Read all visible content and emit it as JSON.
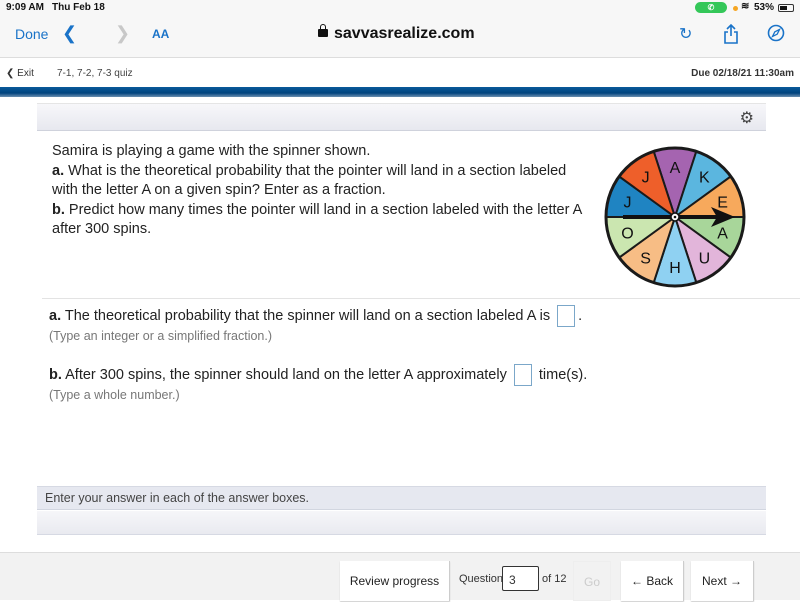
{
  "status_bar": {
    "time": "9:09 AM",
    "date": "Thu Feb 18",
    "call_icon": "phone-icon",
    "wifi_icon": "wifi-icon",
    "battery_percent": "53%"
  },
  "browser": {
    "done_label": "Done",
    "back_icon": "chevron-left-icon",
    "forward_icon": "chevron-right-icon",
    "text_size_label": "AA",
    "url": "savvasrealize.com",
    "reload_icon": "reload-icon",
    "share_icon": "share-icon",
    "compass_icon": "compass-icon"
  },
  "subheader": {
    "exit_label": "Exit",
    "quiz_title": "7-1, 7-2, 7-3 quiz",
    "due": "Due 02/18/21 11:30am"
  },
  "question": {
    "settings_icon": "gear-icon",
    "intro": "Samira is playing a game with the spinner shown.",
    "part_a_label": "a.",
    "part_a_text": " What is the theoretical probability that the pointer will land in a section labeled with the letter A on a given spin? Enter as a fraction.",
    "part_b_label": "b.",
    "part_b_text": " Predict how many times the pointer will land in a section labeled with the letter A after 300 spins.",
    "spinner": {
      "sections": [
        {
          "letter": "A",
          "color": "#a564b0"
        },
        {
          "letter": "K",
          "color": "#5bb6df"
        },
        {
          "letter": "E",
          "color": "#f7a95c"
        },
        {
          "letter": "A",
          "color": "#a8d69a"
        },
        {
          "letter": "U",
          "color": "#e2b5da"
        },
        {
          "letter": "H",
          "color": "#8fd1f2"
        },
        {
          "letter": "S",
          "color": "#f7bd85"
        },
        {
          "letter": "O",
          "color": "#cbe6b0"
        },
        {
          "letter": "J",
          "color": "#1f84c2"
        },
        {
          "letter": "J",
          "color": "#ee5f2a"
        }
      ]
    }
  },
  "answers": {
    "a_label": "a.",
    "a_text": " The theoretical probability that the spinner will land on a section labeled A is",
    "a_suffix": ".",
    "a_value": "",
    "a_hint": "(Type an integer or a simplified fraction.)",
    "b_label": "b.",
    "b_text": " After 300 spins, the spinner should land on the letter A approximately",
    "b_suffix": "time(s).",
    "b_value": "",
    "b_hint": "(Type a whole number.)"
  },
  "help_text": "Enter your answer in each of the answer boxes.",
  "footer": {
    "review_label": "Review progress",
    "question_label": "Question",
    "question_number": "3",
    "of_label": "of 12",
    "go_label": "Go",
    "back_label": "← Back",
    "next_label": "Next →"
  }
}
